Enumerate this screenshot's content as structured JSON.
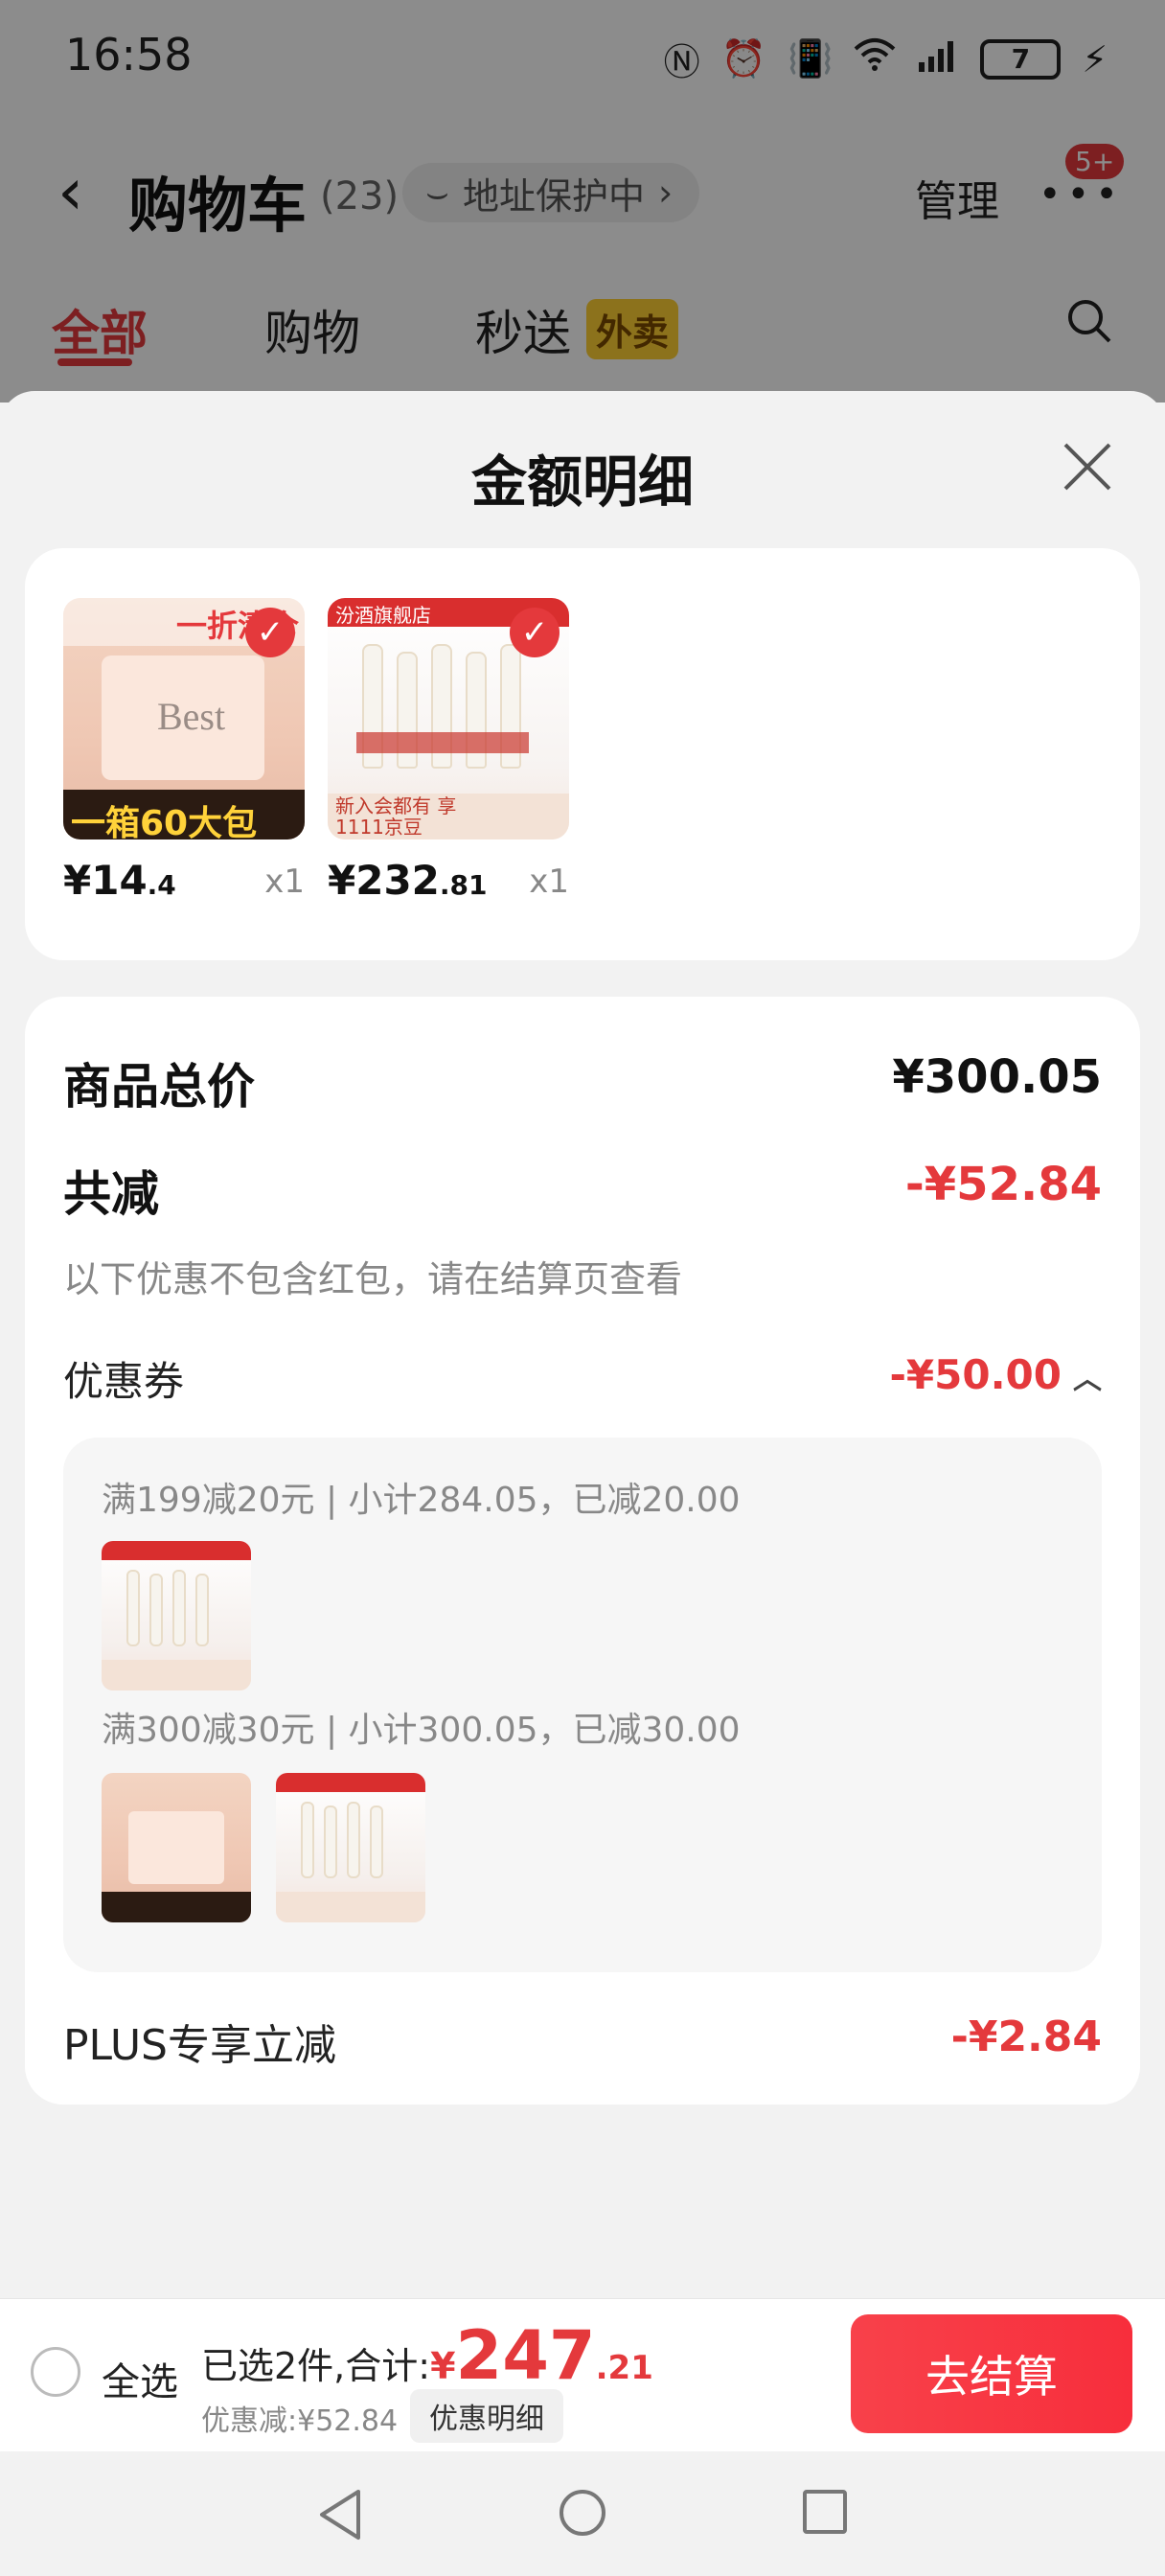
{
  "status_bar": {
    "time": "16:58",
    "battery": "7"
  },
  "cart_header": {
    "title": "购物车",
    "count": "(23)",
    "address_badge": "地址保护中",
    "manage": "管理",
    "message_badge": "5+"
  },
  "tabs": [
    {
      "label": "全部",
      "active": true
    },
    {
      "label": "购物",
      "active": false
    },
    {
      "label": "秒送",
      "active": false
    }
  ],
  "tab_tag": "外卖",
  "sheet": {
    "title": "金额明细"
  },
  "products": [
    {
      "price_int": "¥14",
      "price_dec": ".4",
      "qty": "x1",
      "banner_top": "一折清仓",
      "banner_bottom": "一箱60大包",
      "brand": "Best"
    },
    {
      "price_int": "¥232",
      "price_dec": ".81",
      "qty": "x1",
      "banner_top": "汾酒旗舰店",
      "banner_bottom": "新入会都有 享1111京豆"
    }
  ],
  "details": {
    "total_label": "商品总价",
    "total_value": "¥300.05",
    "discount_label": "共减",
    "discount_value": "-¥52.84",
    "discount_note": "以下优惠不包含红包，请在结算页查看",
    "coupon_label": "优惠券",
    "coupon_value": "-¥50.00",
    "coupon_rules": [
      {
        "text": "满199减20元 | 小计284.05，已减20.00"
      },
      {
        "text": "满300减30元 | 小计300.05，已减30.00"
      }
    ],
    "plus_label": "PLUS专享立减",
    "plus_value": "-¥2.84"
  },
  "bottom_bar": {
    "select_all": "全选",
    "selected_prefix": "已选2件,合计:",
    "yen": "¥",
    "total_int": "247",
    "total_dec": ".21",
    "saved": "优惠减:¥52.84",
    "detail_button": "优惠明细",
    "checkout": "去结算"
  },
  "colors": {
    "accent": "#e4393c",
    "tag_yellow": "#ffcf33"
  }
}
